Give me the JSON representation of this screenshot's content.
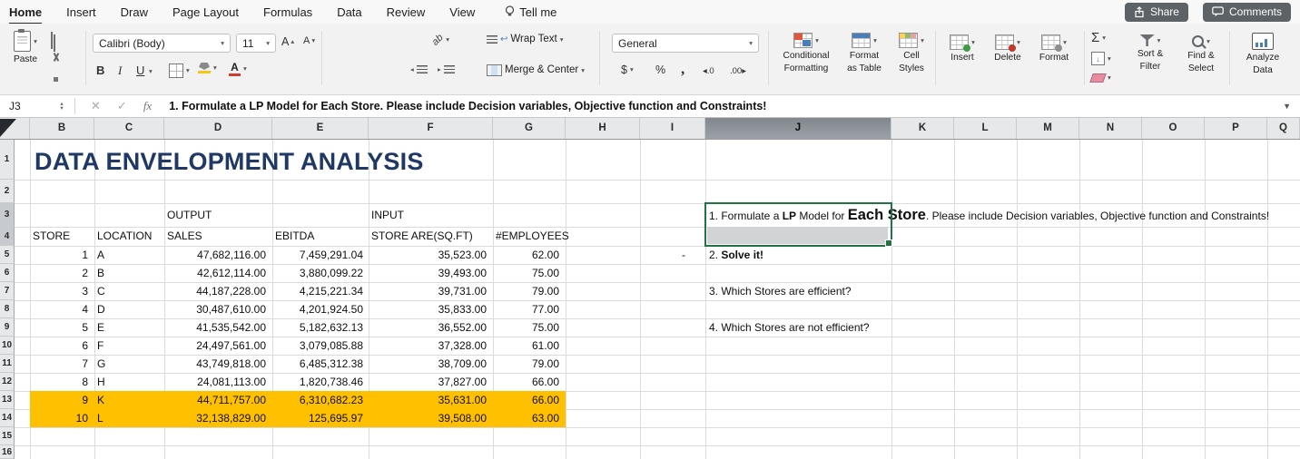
{
  "menu_bar": {
    "tabs": [
      {
        "label": "Home",
        "active": true
      },
      {
        "label": "Insert"
      },
      {
        "label": "Draw"
      },
      {
        "label": "Page Layout"
      },
      {
        "label": "Formulas"
      },
      {
        "label": "Data"
      },
      {
        "label": "Review"
      },
      {
        "label": "View"
      }
    ],
    "tell_me": "Tell me",
    "share_label": "Share",
    "comments_label": "Comments"
  },
  "ribbon": {
    "paste_label": "Paste",
    "font_name": "Calibri (Body)",
    "font_size": "11",
    "bold_glyph": "B",
    "italic_glyph": "I",
    "underline_glyph": "U",
    "grow_font": "A",
    "shrink_font": "A",
    "ori_glyph": "ab",
    "wrap_text_label": "Wrap Text",
    "merge_center_label": "Merge & Center",
    "number_format": "General",
    "currency_glyph": "$",
    "percent_glyph": "%",
    "comma_glyph": ",",
    "inc_decimal": "◂.0",
    "dec_decimal": ".00▸",
    "cf1": "Conditional",
    "cf2": "Formatting",
    "fat1": "Format",
    "fat2": "as Table",
    "cs1": "Cell",
    "cs2": "Styles",
    "insert_label": "Insert",
    "delete_label": "Delete",
    "format_label": "Format",
    "autosum_glyph": "Σ",
    "sf1": "Sort &",
    "sf2": "Filter",
    "fs1": "Find &",
    "fs2": "Select",
    "ad1": "Analyze",
    "ad2": "Data"
  },
  "formula_bar": {
    "name_box": "J3",
    "cancel_glyph": "✕",
    "enter_glyph": "✓",
    "fx_glyph": "fx",
    "content": "1. Formulate a LP Model for Each Store. Please include Decision variables, Objective function and Constraints!"
  },
  "glyphs": {
    "caret": "▾",
    "spin_up": "▴",
    "spin_down": "▾",
    "menu_caret": "▼",
    "wrap_return": "↩",
    "fill_arrow": "↓",
    "indent_left": "◂",
    "indent_right": "▸"
  },
  "sheet": {
    "columns": [
      "B",
      "C",
      "D",
      "E",
      "F",
      "G",
      "H",
      "I",
      "J",
      "K",
      "L",
      "M",
      "N",
      "O",
      "P",
      "Q"
    ],
    "rows": [
      "1",
      "2",
      "3",
      "4",
      "5",
      "6",
      "7",
      "8",
      "9",
      "10",
      "11",
      "12",
      "13",
      "14",
      "15",
      "16"
    ],
    "title": "DATA ENVELOPMENT ANALYSIS",
    "output_label": "OUTPUT",
    "input_label": "INPUT",
    "headers": {
      "store": "STORE",
      "location": "LOCATION",
      "sales": "SALES",
      "ebitda": "EBITDA",
      "area": "STORE ARE(SQ.FT)",
      "employees": "#EMPLOYEES"
    },
    "data": [
      {
        "store": "1",
        "location": "A",
        "sales": "47,682,116.00",
        "ebitda": "7,459,291.04",
        "area": "35,523.00",
        "employees": "62.00",
        "highlight": false
      },
      {
        "store": "2",
        "location": "B",
        "sales": "42,612,114.00",
        "ebitda": "3,880,099.22",
        "area": "39,493.00",
        "employees": "75.00",
        "highlight": false
      },
      {
        "store": "3",
        "location": "C",
        "sales": "44,187,228.00",
        "ebitda": "4,215,221.34",
        "area": "39,731.00",
        "employees": "79.00",
        "highlight": false
      },
      {
        "store": "4",
        "location": "D",
        "sales": "30,487,610.00",
        "ebitda": "4,201,924.50",
        "area": "35,833.00",
        "employees": "77.00",
        "highlight": false
      },
      {
        "store": "5",
        "location": "E",
        "sales": "41,535,542.00",
        "ebitda": "5,182,632.13",
        "area": "36,552.00",
        "employees": "75.00",
        "highlight": false
      },
      {
        "store": "6",
        "location": "F",
        "sales": "24,497,561.00",
        "ebitda": "3,079,085.88",
        "area": "37,328.00",
        "employees": "61.00",
        "highlight": false
      },
      {
        "store": "7",
        "location": "G",
        "sales": "43,749,818.00",
        "ebitda": "6,485,312.38",
        "area": "38,709.00",
        "employees": "79.00",
        "highlight": false
      },
      {
        "store": "8",
        "location": "H",
        "sales": "24,081,113.00",
        "ebitda": "1,820,738.46",
        "area": "37,827.00",
        "employees": "66.00",
        "highlight": false
      },
      {
        "store": "9",
        "location": "K",
        "sales": "44,711,757.00",
        "ebitda": "6,310,682.23",
        "area": "35,631.00",
        "employees": "66.00",
        "highlight": true
      },
      {
        "store": "10",
        "location": "L",
        "sales": "32,138,829.00",
        "ebitda": "125,695.97",
        "area": "39,508.00",
        "employees": "63.00",
        "highlight": true
      }
    ],
    "dash_cell": "-",
    "q1": {
      "pre": "1. Formulate a ",
      "lp": "LP",
      "mid": " Model for ",
      "big": "Each Store",
      "post": ". Please include Decision variables, Objective function and Constraints!"
    },
    "q2_prefix": "2. ",
    "q2_bold": "Solve it!",
    "q3": "3. Which Stores are efficient?",
    "q4": "4. Which Stores are not efficient?",
    "colors": {
      "highlight": "#FFC000",
      "title": "#1F3864",
      "selection": "#217346"
    }
  }
}
